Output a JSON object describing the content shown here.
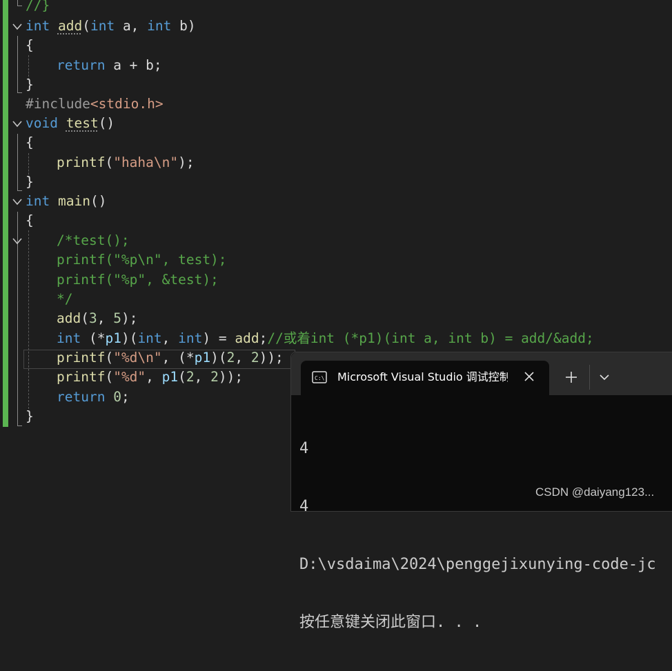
{
  "editor": {
    "lines": {
      "l0": {
        "a": "//}"
      },
      "l1": {
        "kw": "int",
        "fn": "add",
        "p1": "(",
        "kw2": "int",
        "v1": " a, ",
        "kw3": "int",
        "v2": " b)"
      },
      "l2": {
        "p": "{"
      },
      "l3": {
        "kw": "return",
        "rest": " a + b;"
      },
      "l4": {
        "p": "}"
      },
      "l5": {
        "pp": "#include",
        "inc": "<stdio.h>"
      },
      "l6": {
        "kw": "void",
        "fn": "test",
        "p": "()"
      },
      "l7": {
        "p": "{"
      },
      "l8": {
        "fn": "printf",
        "p1": "(",
        "str": "\"haha\\n\"",
        "p2": ");"
      },
      "l9": {
        "p": "}"
      },
      "l10": {
        "kw": "int",
        "fn": "main",
        "p": "()"
      },
      "l11": {
        "p": "{"
      },
      "l12": {
        "cmt": "/*test();"
      },
      "l13": {
        "cmt": "printf(\"%p\\n\", test);"
      },
      "l14": {
        "cmt": "printf(\"%p\", &test);"
      },
      "l15": {
        "cmt": "*/"
      },
      "l16": {
        "fn": "add",
        "p1": "(",
        "n1": "3",
        "c": ", ",
        "n2": "5",
        "p2": ");"
      },
      "l17": {
        "kw": "int",
        "a": " (*",
        "v": "p1",
        "b": ")(",
        "kw2": "int",
        "c": ", ",
        "kw3": "int",
        "d": ") = ",
        "fn": "add",
        "e": ";",
        "cmt": "//或着int (*p1)(int a, int b) = add/&add;"
      },
      "l18": {
        "fn": "printf",
        "p1": "(",
        "str": "\"%d\\n\"",
        "a": ", (*",
        "v": "p1",
        "b": ")(",
        "n1": "2",
        "c": ", ",
        "n2": "2",
        "d": "));"
      },
      "l19": {
        "fn": "printf",
        "p1": "(",
        "str": "\"%d\"",
        "a": ", ",
        "v": "p1",
        "b": "(",
        "n1": "2",
        "c": ", ",
        "n2": "2",
        "d": "));"
      },
      "l20": {
        "kw": "return",
        "a": " ",
        "n": "0",
        "b": ";"
      },
      "l21": {
        "p": "}"
      }
    }
  },
  "terminal": {
    "tab_title": "Microsoft Visual Studio 调试控制台",
    "tab_icon": "terminal-icon",
    "close_icon": "close-icon",
    "new_tab_icon": "plus-icon",
    "dropdown_icon": "chevron-down-icon",
    "output": [
      "4",
      "4",
      "D:\\vsdaima\\2024\\penggejixunying-code-jc",
      "按任意键关闭此窗口. . ."
    ]
  },
  "watermark": "CSDN @daiyang123...",
  "colors": {
    "editor_bg": "#1e1e1e",
    "keyword": "#569cd6",
    "function": "#dcdcaa",
    "variable": "#9cdcfe",
    "string": "#d69d85",
    "number": "#b5cea8",
    "comment": "#57a64a",
    "change_bar": "#5bb552",
    "terminal_bg": "#0c0c0c",
    "terminal_tabbar": "#2b2b2b"
  }
}
